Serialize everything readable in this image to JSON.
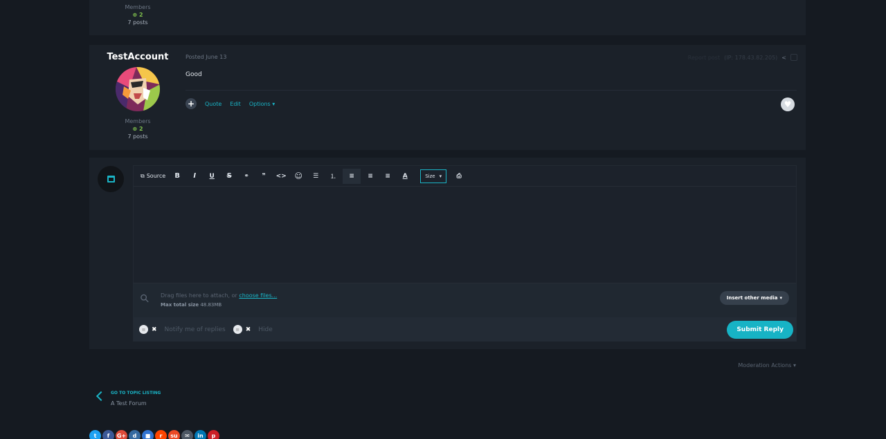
{
  "prev_post": {
    "group": "Members",
    "reputation": "2",
    "posts": "7 posts"
  },
  "post": {
    "author": "TestAccount",
    "group": "Members",
    "reputation": "2",
    "posts": "7 posts",
    "posted": "Posted June 13",
    "report_label": "Report post",
    "ip": "(IP: 178.43.82.205)",
    "content": "Good",
    "actions": {
      "quote": "Quote",
      "edit": "Edit",
      "options": "Options"
    }
  },
  "editor": {
    "source_label": "Source",
    "toolbar": [
      {
        "name": "bold",
        "glyph": "B"
      },
      {
        "name": "italic",
        "glyph": "I"
      },
      {
        "name": "underline",
        "glyph": "U"
      },
      {
        "name": "strikethrough",
        "glyph": "S"
      },
      {
        "name": "link",
        "glyph": "⚭"
      },
      {
        "name": "quote",
        "glyph": "❞❞"
      },
      {
        "name": "code",
        "glyph": "<>"
      },
      {
        "name": "emoji",
        "glyph": "☺"
      },
      {
        "name": "bullet-list",
        "glyph": "☰"
      },
      {
        "name": "numbered-list",
        "glyph": "⒈"
      },
      {
        "name": "align-left",
        "glyph": "≡"
      },
      {
        "name": "align-center",
        "glyph": "≡"
      },
      {
        "name": "align-right",
        "glyph": "≡"
      },
      {
        "name": "text-color",
        "glyph": "A"
      }
    ],
    "size_label": "Size",
    "attach_text": "Drag files here to attach, or",
    "choose_files": "choose files...",
    "max_size_label": "Max total size",
    "max_size_value": "48.83MB",
    "insert_media": "Insert other media",
    "notify_label": "Notify me of replies",
    "hide_label": "Hide",
    "submit": "Submit Reply"
  },
  "moderation": "Moderation Actions",
  "back": {
    "label": "GO TO TOPIC LISTING",
    "forum": "A Test Forum"
  },
  "social": [
    {
      "name": "twitter",
      "glyph": "t",
      "color": "#1da1f2"
    },
    {
      "name": "facebook",
      "glyph": "f",
      "color": "#3b5998"
    },
    {
      "name": "google-plus",
      "glyph": "G+",
      "color": "#dd4b39"
    },
    {
      "name": "digg",
      "glyph": "d",
      "color": "#356aa0"
    },
    {
      "name": "delicious",
      "glyph": "■",
      "color": "#3274d1"
    },
    {
      "name": "reddit",
      "glyph": "r",
      "color": "#ff4500"
    },
    {
      "name": "stumbleupon",
      "glyph": "su",
      "color": "#eb4924"
    },
    {
      "name": "email",
      "glyph": "✉",
      "color": "#4d5763"
    },
    {
      "name": "linkedin",
      "glyph": "in",
      "color": "#0077b5"
    },
    {
      "name": "pinterest",
      "glyph": "p",
      "color": "#cb2027"
    }
  ],
  "colors": {
    "accent": "#1ab5c7",
    "background": "#151a21",
    "card": "#1b2129",
    "positive": "#7fbf4d"
  }
}
